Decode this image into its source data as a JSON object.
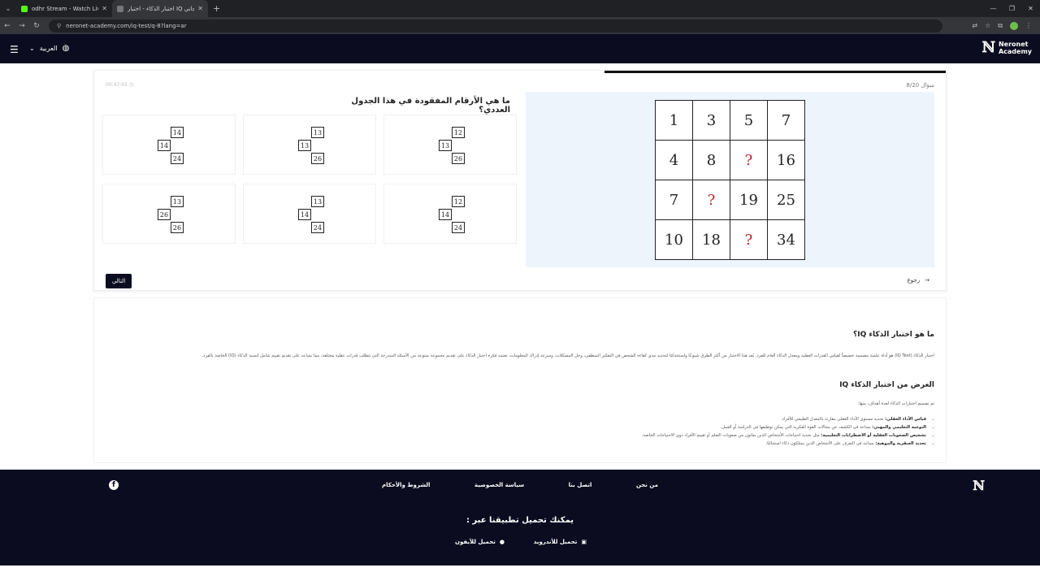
{
  "browser": {
    "tabs": [
      {
        "title": "odhr Stream - Watch Live on Ki",
        "favicon_color": "#53fc18",
        "active": false
      },
      {
        "title": "اختبار الذكاء - اختبار IQ مجاني",
        "favicon_color": "#777777",
        "active": true
      }
    ],
    "url": "neronet-academy.com/iq-test/q-8?lang=ar"
  },
  "header": {
    "language": "العربية",
    "brand_line1": "Neronet",
    "brand_line2": "Academy"
  },
  "quiz": {
    "counter": "سؤال 8/20",
    "timer": "00:47:01",
    "question": "ما هي الأرقام المفقودة في هذا الجدول العددي؟",
    "grid": [
      [
        "1",
        "3",
        "5",
        "7"
      ],
      [
        "4",
        "8",
        "?",
        "16"
      ],
      [
        "7",
        "?",
        "19",
        "25"
      ],
      [
        "10",
        "18",
        "?",
        "34"
      ]
    ],
    "options": [
      {
        "top": "14",
        "left": "14",
        "bottom": "24"
      },
      {
        "top": "13",
        "left": "13",
        "bottom": "26"
      },
      {
        "top": "12",
        "left": "13",
        "bottom": "26"
      },
      {
        "top": "13",
        "left": "26",
        "bottom": "26"
      },
      {
        "top": "13",
        "left": "14",
        "bottom": "24"
      },
      {
        "top": "12",
        "left": "14",
        "bottom": "24"
      }
    ],
    "next_label": "التالي",
    "back_label": "رجوع",
    "colors": {
      "question_mark": "#c0202a",
      "panel": "#edf4fc"
    }
  },
  "info": {
    "heading1": "ما هو اختبار الذكاء IQ؟",
    "paragraph1": "اختبار الذكاء (IQ Test) هو أداة علمية مصممة خصيصاً لقياس القدرات العقلية ومعدل الذكاء العام للفرد. يُعد هذا الاختبار من أكثر الطرق شيوعًا واستخدامًا لتحديد مدى كفاءة الشخص في التفكير المنطقي، وحل المشكلات، وسرعة إدراك المعلومات. تعتمد فكرة اختبار الذكاء على تقديم مجموعة متنوعة من الأسئلة المتدرجة التي تتطلب قدرات عقلية مختلفة، مما يساعد على تقديم تقييم شامل لنسبة الذكاء (IQ) الخاصة بالفرد.",
    "heading2": "الغرض من اختبار الذكاء IQ",
    "paragraph2": "تم تصميم اختبارات الذكاء لعدة أهداف، منها:",
    "bullets": [
      {
        "bold": "قياس الأداء العقلي:",
        "text": " تحديد مستوى الأداء العقلي مقارنة بالمعدل الطبيعي للأفراد."
      },
      {
        "bold": "التوجيه التعليمي والمهني:",
        "text": " يساعد في الكشف عن مجالات القوة الفكرية التي يمكن توظيفها في الدراسة أو العمل."
      },
      {
        "bold": "تشخيص الصعوبات العقلية أو الاضطرابات التعليمية:",
        "text": " مثل تحديد احتياجات الأشخاص الذين يعانون من صعوبات التعلم أو تقييم الأفراد ذوي الاحتياجات الخاصة."
      },
      {
        "bold": "تحديد العبقرية والموهبة:",
        "text": " يساعد في التعرف على الأشخاص الذين يمتلكون ذكاء استثنائيًا."
      }
    ]
  },
  "footer": {
    "links": [
      "من نحن",
      "اتصل بنا",
      "سياسة الخصوصية",
      "الشروط والأحكام"
    ],
    "app_title": "يمكنك تحميل تطبيقنا عبر :",
    "android_label": "تحميل للأندرويد",
    "iphone_label": "تحميل للآيفون"
  }
}
